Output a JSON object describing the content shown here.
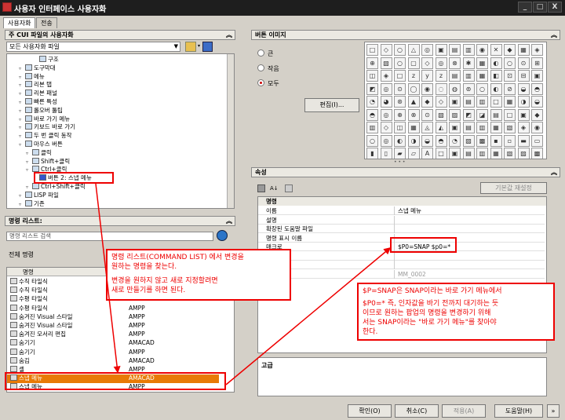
{
  "window": {
    "title": "사용자 인터페이스 사용자화",
    "minimize": "_",
    "maximize": "□",
    "close": "X"
  },
  "tabs": [
    {
      "label": "사용자화"
    },
    {
      "label": "전송"
    }
  ],
  "cui_panel": {
    "title": "주 CUI 파일의 사용자화",
    "file_select": "모든 사용자화 파일",
    "tree": [
      {
        "label": "구조",
        "indent": 3,
        "icon": "gear-icon"
      },
      {
        "label": "도구막대",
        "indent": 1,
        "icon": "toolbar-icon"
      },
      {
        "label": "메뉴",
        "indent": 1,
        "icon": "menu-icon"
      },
      {
        "label": "리본 탭",
        "indent": 1,
        "icon": "ribbon-tab-icon"
      },
      {
        "label": "리본 패널",
        "indent": 1,
        "icon": "ribbon-panel-icon"
      },
      {
        "label": "빠른 특성",
        "indent": 1,
        "icon": "quick-properties-icon"
      },
      {
        "label": "롤오버 툴팁",
        "indent": 1,
        "icon": "rollover-tooltip-icon"
      },
      {
        "label": "바로 가기 메뉴",
        "indent": 1,
        "icon": "shortcut-menu-icon"
      },
      {
        "label": "키보드 바로 가기",
        "indent": 1,
        "icon": "keyboard-icon"
      },
      {
        "label": "두 번 클릭 동작",
        "indent": 1,
        "icon": "double-click-icon"
      },
      {
        "label": "마우스 버튼",
        "indent": 1,
        "icon": "mouse-icon"
      },
      {
        "label": "클릭",
        "indent": 2,
        "icon": "mouse-button-icon"
      },
      {
        "label": "Shift+클릭",
        "indent": 2,
        "icon": "mouse-button-icon"
      },
      {
        "label": "Ctrl+클릭",
        "indent": 2,
        "icon": "mouse-button-icon"
      },
      {
        "label": "버튼 2: 스냅 메뉴",
        "indent": 3,
        "icon": "star-icon"
      },
      {
        "label": "Ctrl+Shift+클릭",
        "indent": 2,
        "icon": "mouse-button-icon"
      },
      {
        "label": "LISP 파일",
        "indent": 1,
        "icon": "lisp-icon"
      },
      {
        "label": "기존",
        "indent": 1,
        "icon": "legacy-icon"
      }
    ]
  },
  "command_list": {
    "title": "명령 리스트:",
    "search_placeholder": "명령 리스트 검색",
    "filter_value": "전체 명령",
    "col_command": "명령",
    "col_source": "소스",
    "rows": [
      {
        "name": "수직 타일식",
        "source": ""
      },
      {
        "name": "수직 타일식",
        "source": "AMPP"
      },
      {
        "name": "수평 타일식",
        "source": "AMPP"
      },
      {
        "name": "수평 타일식",
        "source": "AMPP"
      },
      {
        "name": "숨겨진 Visual 스타일",
        "source": "AMPP"
      },
      {
        "name": "숨겨진 Visual 스타일",
        "source": "AMPP"
      },
      {
        "name": "숨겨진 모서리 편집",
        "source": "AMPP"
      },
      {
        "name": "숨기기",
        "source": "AMACAD"
      },
      {
        "name": "숨기기",
        "source": "AMPP"
      },
      {
        "name": "숨김",
        "source": "AMACAD"
      },
      {
        "name": "셸",
        "source": "AMPP"
      },
      {
        "name": "스냅 메뉴",
        "source": "AMACAD"
      },
      {
        "name": "스냅 메뉴",
        "source": "AMPP"
      }
    ]
  },
  "button_image": {
    "title": "버튼 이미지",
    "radio_large": "큰",
    "radio_small": "작음",
    "radio_both": "모두",
    "edit_button": "편집(I)...",
    "glyphs": [
      "□",
      "◇",
      "○",
      "△",
      "◎",
      "▣",
      "▤",
      "▥",
      "◉",
      "✕",
      "◆",
      "▦",
      "◈",
      "⊕",
      "▧",
      "○",
      "▢",
      "◇",
      "◎",
      "⊗",
      "✱",
      "▦",
      "◐",
      "○",
      "⊙",
      "⊞",
      "◫",
      "◈",
      "□",
      "z",
      "y",
      "z",
      "▤",
      "▥",
      "▦",
      "◧",
      "⊡",
      "⊟",
      "▣",
      "◩",
      "◎",
      "⊙",
      "◯",
      "◉",
      "◌",
      "◍",
      "⊚",
      "○",
      "◐",
      "⊘",
      "◒",
      "◓",
      "◔",
      "◕",
      "⊛",
      "▲",
      "◆",
      "◇",
      "▣",
      "▤",
      "▥",
      "□",
      "▦",
      "◑",
      "◒",
      "◓",
      "◎",
      "⊕",
      "⊗",
      "⊙",
      "▧",
      "▨",
      "◩",
      "◪",
      "▤",
      "□",
      "▣",
      "◆",
      "▥",
      "◇",
      "◫",
      "▦",
      "◬",
      "◭",
      "▣",
      "▤",
      "▥",
      "▦",
      "▧",
      "◈",
      "◉",
      "○",
      "◎",
      "◐",
      "◑",
      "◒",
      "◓",
      "◔",
      "▨",
      "▩",
      "▪",
      "▫",
      "▬",
      "▭",
      "▮",
      "▯",
      "▰",
      "▱",
      "A",
      "□",
      "▣",
      "▤",
      "▥",
      "▦",
      "▧",
      "▨",
      "▩",
      "◆",
      "◇",
      "◈",
      "◉",
      "◊",
      "○",
      "◌",
      "◍",
      "◎",
      "●",
      "◐",
      "◑",
      "◒",
      "◓",
      "◔",
      "◕",
      "◖",
      "◗",
      "◘",
      "◙",
      "◚",
      "◛",
      "◜",
      "◝"
    ]
  },
  "properties": {
    "title": "속성",
    "reset_button": "기본값 재설정",
    "section_command": "명령",
    "rows": [
      {
        "key": "이름",
        "value": "스냅 메뉴"
      },
      {
        "key": "설명",
        "value": ""
      },
      {
        "key": "확장된 도움말 파일",
        "value": ""
      },
      {
        "key": "명령 표시 이름",
        "value": ""
      },
      {
        "key": "매크로",
        "value": "$P0=SNAP $p0=*"
      },
      {
        "key": "",
        "value": ""
      },
      {
        "key": "",
        "value": ""
      },
      {
        "key": "",
        "value": "MM_0002"
      }
    ],
    "partial_label": "지",
    "advanced_label": "고급"
  },
  "footer": {
    "ok": "확인(O)",
    "cancel": "취소(C)",
    "apply": "적용(A)",
    "help": "도움말(H)"
  },
  "annotations": {
    "left_line1": "명령 리스트(COMMAND LIST) 에서 변경을",
    "left_line2": "원하는 명령을 찾는다.",
    "left_line3": "변경을 원하지 않고 새로 지정할려면",
    "left_line4": "새로 만들기를 하면 된다.",
    "right_line1": "$P=SNAP은 SNAP이라는 바로 가기 메뉴에서",
    "right_line2": "$P0=* 즉, 인자값을 바기 전까지 대기하는 듯",
    "right_line3": "이므로 원하는 팝업의 명령을 변경하기 위해",
    "right_line4": "서는 SNAP이라는 \"바로 가기 메뉴\"를 찾아야",
    "right_line5": "한다."
  },
  "colors": {
    "accent": "#e87a06",
    "annotation": "#ee0000",
    "panel_bg": "#d4d0c8"
  }
}
